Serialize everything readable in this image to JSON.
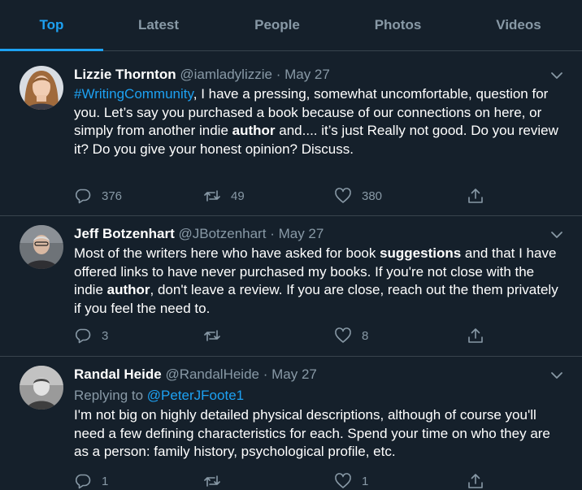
{
  "tabs": [
    {
      "label": "Top",
      "active": true
    },
    {
      "label": "Latest",
      "active": false
    },
    {
      "label": "People",
      "active": false
    },
    {
      "label": "Photos",
      "active": false
    },
    {
      "label": "Videos",
      "active": false
    }
  ],
  "tweets": [
    {
      "name": "Lizzie Thornton",
      "handle": "@iamladylizzie",
      "dot": "·",
      "date": "May 27",
      "body": {
        "hashtag": "#WritingCommunity",
        "t1": ", I have a pressing, somewhat uncomfortable, question for you. Let’s say you purchased a book because of our connections on here, or simply from another indie ",
        "b1": "author",
        "t2": " and.... it’s just Really not good. Do you review it? Do you give your honest opinion? Discuss."
      },
      "replies": "376",
      "retweets": "49",
      "likes": "380"
    },
    {
      "name": "Jeff Botzenhart",
      "handle": "@JBotzenhart",
      "dot": "·",
      "date": "May 27",
      "body": {
        "t1": "Most of the writers here who have asked for book ",
        "b1": "suggestions",
        "t2": " and that I have offered links to have never purchased my books. If you're not close with the indie ",
        "b2": "author",
        "t3": ", don't leave a review. If you are close, reach out the them privately if you feel the need to."
      },
      "replies": "3",
      "retweets": "",
      "likes": "8"
    },
    {
      "name": "Randal Heide",
      "handle": "@RandalHeide",
      "dot": "·",
      "date": "May 27",
      "replying_label": "Replying to ",
      "replying_handle": "@PeterJFoote1",
      "body": {
        "t1": "I'm not big on highly detailed physical descriptions, although of course you'll need a few defining characteristics for each.  Spend your time on who they are as a person: family history, psychological profile, etc."
      },
      "replies": "1",
      "retweets": "",
      "likes": "1"
    }
  ],
  "colors": {
    "background": "#15202b",
    "accent": "#1da1f2",
    "muted": "#8899a6",
    "divider": "#38444d"
  },
  "icons": [
    "reply-icon",
    "retweet-icon",
    "like-icon",
    "share-icon",
    "chevron-down-icon"
  ]
}
